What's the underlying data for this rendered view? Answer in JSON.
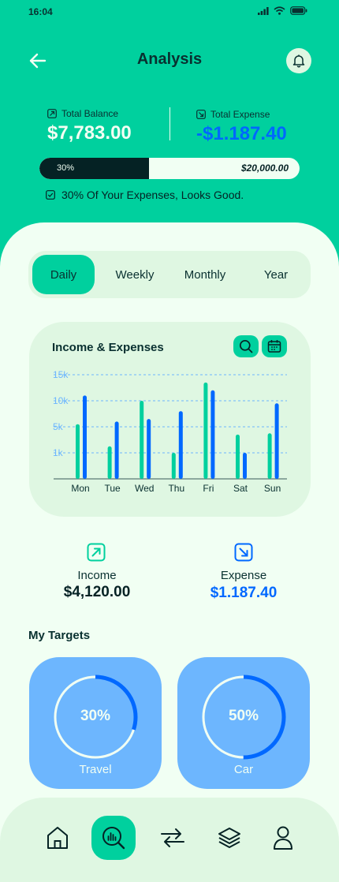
{
  "status": {
    "time": "16:04"
  },
  "header": {
    "title": "Analysis"
  },
  "balance": {
    "total_balance_label": "Total Balance",
    "total_balance": "$7,783.00",
    "total_expense_label": "Total Expense",
    "total_expense": "-$1.187.40",
    "progress_percent_label": "30%",
    "progress_fraction": 0.3,
    "goal": "$20,000.00",
    "message": "30% Of Your Expenses, Looks Good."
  },
  "tabs": [
    "Daily",
    "Weekly",
    "Monthly",
    "Year"
  ],
  "active_tab": "Daily",
  "chart_card": {
    "title": "Income & Expenses"
  },
  "chart_data": {
    "type": "bar",
    "title": "Income & Expenses",
    "categories": [
      "Mon",
      "Tue",
      "Wed",
      "Thu",
      "Fri",
      "Sat",
      "Sun"
    ],
    "y_ticks": [
      "15k",
      "10k",
      "5k",
      "1k"
    ],
    "series": [
      {
        "color": "#00d09e",
        "values": [
          5.5,
          2,
          10,
          1,
          13.5,
          3.8,
          4
        ]
      },
      {
        "color": "#0068ff",
        "values": [
          11,
          6,
          6.5,
          8,
          12,
          1,
          9.5
        ]
      }
    ]
  },
  "summary": {
    "income_label": "Income",
    "income_value": "$4,120.00",
    "expense_label": "Expense",
    "expense_value": "$1.187.40"
  },
  "targets": {
    "title": "My Targets",
    "items": [
      {
        "label": "Travel",
        "percent": "30%",
        "fraction": 0.3
      },
      {
        "label": "Car",
        "percent": "50%",
        "fraction": 0.5
      }
    ]
  },
  "colors": {
    "accent": "#00d09e",
    "dark": "#052224",
    "blue": "#0068ff",
    "target_bg": "#6db6fe",
    "light_panel": "#f1fff3",
    "soft_panel": "#dff7e2"
  },
  "nav": [
    "home-icon",
    "analysis-icon",
    "transactions-icon",
    "layers-icon",
    "profile-icon"
  ]
}
